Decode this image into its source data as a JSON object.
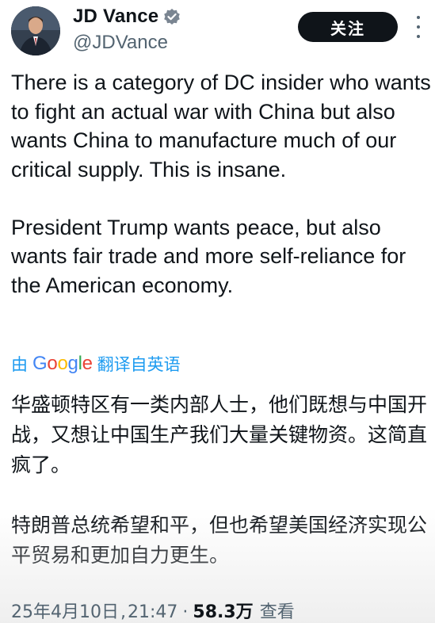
{
  "author": {
    "display_name": "JD Vance",
    "handle": "@JDVance",
    "verified": true,
    "avatar": "profile-photo"
  },
  "actions": {
    "follow_label": "关注",
    "more_icon": "more-vertical-icon"
  },
  "post": {
    "text": "There is a category of DC insider who wants to fight an actual war with China but also wants China to manufacture much of our critical supply. This is insane.\n\nPresident Trump wants peace, but also wants fair trade and more self-reliance for the American economy."
  },
  "translation": {
    "prefix": "由",
    "provider": "Google",
    "suffix": "翻译自英语",
    "text": "华盛顿特区有一类内部人士，他们既想与中国开战，又想让中国生产我们大量关键物资。这简直疯了。\n\n特朗普总统希望和平，但也希望美国经济实现公平贸易和更加自力更生。"
  },
  "meta": {
    "date": "25年4月10日",
    "separator": "·",
    "time": "21:47",
    "views": "58.3万",
    "views_label": "查看"
  },
  "colors": {
    "accent": "#1d9bf0",
    "text": "#0f1419",
    "secondary": "#536471",
    "button_bg": "#0f1419"
  }
}
